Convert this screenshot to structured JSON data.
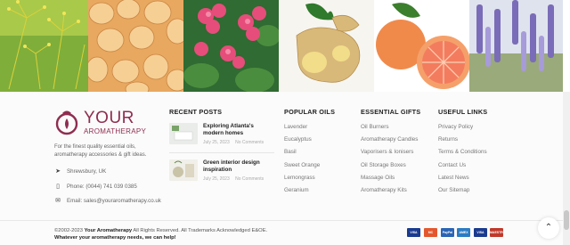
{
  "banner": {
    "images": [
      {
        "name": "fennel-image"
      },
      {
        "name": "resin-image"
      },
      {
        "name": "geranium-image"
      },
      {
        "name": "ginger-image"
      },
      {
        "name": "grapefruit-image"
      },
      {
        "name": "lavender-image"
      }
    ]
  },
  "brand": {
    "logo_main": "YOUR",
    "logo_sub": "AROMATHERAPY",
    "tagline": "For the finest quality essential oils, aromatherapy accessories & gift ideas.",
    "accent": "#8f2d50"
  },
  "contact": {
    "location": "Shrewsbury, UK",
    "phone": "Phone: (0044) 741 039 0385",
    "email": "Email: sales@youraromatherapy.co.uk"
  },
  "recent_posts": {
    "title": "RECENT POSTS",
    "items": [
      {
        "title": "Exploring Atlanta's modern homes",
        "date": "July 25, 2023",
        "comments": "No Comments"
      },
      {
        "title": "Green interior design inspiration",
        "date": "July 25, 2023",
        "comments": "No Comments"
      }
    ]
  },
  "popular_oils": {
    "title": "POPULAR OILS",
    "items": [
      "Lavender",
      "Eucalyptus",
      "Basil",
      "Sweet Orange",
      "Lemongrass",
      "Geranium"
    ]
  },
  "essential_gifts": {
    "title": "ESSENTIAL GIFTS",
    "items": [
      "Oil Burners",
      "Aromatherapy Candles",
      "Vaporisers & Ionisers",
      "Oil Storage Boxes",
      "Massage Oils",
      "Aromatherapy Kits"
    ]
  },
  "useful_links": {
    "title": "USEFUL LINKS",
    "items": [
      "Privacy Policy",
      "Returns",
      "Terms & Conditions",
      "Contact Us",
      "Latest News",
      "Our Sitemap"
    ]
  },
  "footer": {
    "copyright_pre": "©2002-2023 ",
    "copyright_brand": "Your Aromatherapy",
    "copyright_post": " All Rights Reserved. All Trademarks Acknowledged E&OE.",
    "slogan": "Whatever your aromatherapy needs, we can help!",
    "payments": [
      {
        "label": "VISA",
        "color": "#1a3a8f"
      },
      {
        "label": "MC",
        "color": "#e4572e"
      },
      {
        "label": "PayPal",
        "color": "#2a64b5"
      },
      {
        "label": "AMEX",
        "color": "#2b7bc2"
      },
      {
        "label": "VISA",
        "color": "#1a3a8f"
      },
      {
        "label": "MAESTRO",
        "color": "#c0392b"
      }
    ],
    "scroll_top_icon": "chevron-up-icon"
  }
}
